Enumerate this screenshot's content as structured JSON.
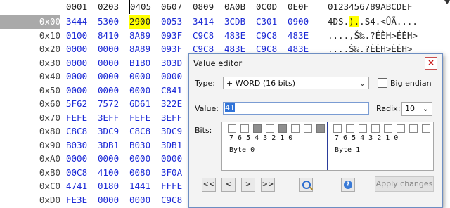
{
  "hex": {
    "column_headers": [
      "0001",
      "0203",
      "0405",
      "0607",
      "0809",
      "0A0B",
      "0C0D",
      "0E0F"
    ],
    "ascii_header": "0123456789ABCDEF",
    "rows": [
      {
        "offset": "0x00",
        "cells": [
          "3444",
          "5300",
          "2900",
          "0053",
          "3414",
          "3CDB",
          "C301",
          "0900"
        ],
        "ascii_pre": "4DS.",
        "ascii_hl": ").",
        "ascii_post": ".S4.<ÛÃ...."
      },
      {
        "offset": "0x10",
        "cells": [
          "0100",
          "8410",
          "8A89",
          "093F",
          "C9C8",
          "483E",
          "C9C8",
          "483E"
        ],
        "ascii": "....‚Š‰.?ÉÈH>ÉÈH>"
      },
      {
        "offset": "0x20",
        "cells": [
          "0000",
          "0000",
          "8A89",
          "093F",
          "C9C8",
          "483E",
          "C9C8",
          "483E"
        ],
        "ascii": "....Š‰.?ÉÈH>ÉÈH>"
      },
      {
        "offset": "0x30",
        "cells": [
          "0000",
          "0000",
          "B1B0",
          "303D",
          "",
          "",
          "",
          ""
        ],
        "ascii": ""
      },
      {
        "offset": "0x40",
        "cells": [
          "0000",
          "0000",
          "0000",
          "0000",
          "",
          "",
          "",
          ""
        ],
        "ascii": ""
      },
      {
        "offset": "0x50",
        "cells": [
          "0000",
          "0000",
          "0000",
          "C841",
          "",
          "",
          "",
          ""
        ],
        "ascii": ""
      },
      {
        "offset": "0x60",
        "cells": [
          "5F62",
          "7572",
          "6D61",
          "322E",
          "",
          "",
          "",
          ""
        ],
        "ascii": ""
      },
      {
        "offset": "0x70",
        "cells": [
          "FEFE",
          "3EFF",
          "FEFE",
          "3EFF",
          "",
          "",
          "",
          ""
        ],
        "ascii": ""
      },
      {
        "offset": "0x80",
        "cells": [
          "C8C8",
          "3DC9",
          "C8C8",
          "3DC9",
          "",
          "",
          "",
          ""
        ],
        "ascii": ""
      },
      {
        "offset": "0x90",
        "cells": [
          "B030",
          "3DB1",
          "B030",
          "3DB1",
          "",
          "",
          "",
          ""
        ],
        "ascii": ""
      },
      {
        "offset": "0xA0",
        "cells": [
          "0000",
          "0000",
          "0000",
          "0000",
          "",
          "",
          "",
          ""
        ],
        "ascii": ""
      },
      {
        "offset": "0xB0",
        "cells": [
          "00C8",
          "4100",
          "0080",
          "3F0A",
          "",
          "",
          "",
          ""
        ],
        "ascii": ""
      },
      {
        "offset": "0xC0",
        "cells": [
          "4741",
          "0180",
          "1441",
          "FFFE",
          "",
          "",
          "",
          ""
        ],
        "ascii": ""
      },
      {
        "offset": "0xD0",
        "cells": [
          "FE3E",
          "0000",
          "0000",
          "C9C8",
          "",
          "",
          "",
          ""
        ],
        "ascii": ""
      }
    ]
  },
  "dialog": {
    "title": "Value editor",
    "close_label": "×",
    "type_label": "Type:",
    "type_value": "+ WORD (16 bits)",
    "big_endian_label": "Big endian",
    "value_label": "Value:",
    "value_text": "41",
    "radix_label": "Radix:",
    "radix_value": "10",
    "bits_label": "Bits:",
    "bit_numbers": "7 6 5 4 3 2 1 0",
    "byte0_label": "Byte 0",
    "byte1_label": "Byte 1",
    "byte0_bits": [
      0,
      0,
      1,
      0,
      1,
      0,
      0,
      1
    ],
    "byte1_bits": [
      0,
      0,
      0,
      0,
      0,
      0,
      0,
      0
    ],
    "nav": {
      "first": "<<",
      "prev": "<",
      "next": ">",
      "last": ">>"
    },
    "apply_label": "Apply changes"
  }
}
